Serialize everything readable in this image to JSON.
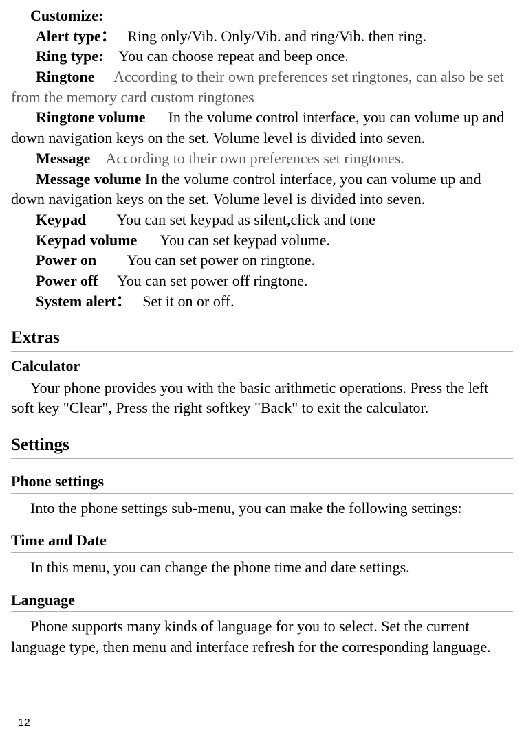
{
  "customize": {
    "header": "Customize:",
    "items": {
      "alert_type_label": "Alert type：",
      "alert_type_text": "Ring only/Vib. Only/Vib. and ring/Vib. then ring.",
      "ring_type_label": "Ring type:",
      "ring_type_text": "You can choose repeat and beep once.",
      "ringtone_label": "Ringtone",
      "ringtone_text": "According to their own preferences set ringtones, can also be set from the memory card custom ringtones",
      "ringtone_volume_label": "Ringtone volume",
      "ringtone_volume_text": "In the volume control interface, you can volume up and down navigation keys on the set. Volume level is divided into seven.",
      "message_label": "Message",
      "message_text": "According to their own preferences set ringtones.",
      "message_volume_label": "Message volume",
      "message_volume_text": " In the volume control interface, you can volume up and down navigation keys on the set. Volume level is divided into seven.",
      "keypad_label": "Keypad",
      "keypad_text": "You can set keypad as silent,click and tone",
      "keypad_volume_label": "Keypad volume",
      "keypad_volume_text": "You can set keypad volume.",
      "power_on_label": "Power on",
      "power_on_text": "You can set power on ringtone.",
      "power_off_label": "Power off",
      "power_off_text": "You can set power off ringtone.",
      "system_alert_label": "System alert：",
      "system_alert_text": "Set it on or off."
    }
  },
  "extras": {
    "heading": "Extras",
    "calculator_heading": "Calculator",
    "calculator_text": "Your phone provides you with the basic arithmetic operations. Press the left soft key \"Clear\", Press the right softkey \"Back\" to exit the calculator."
  },
  "settings": {
    "heading": "Settings",
    "phone_settings_heading": "Phone settings",
    "phone_settings_text": "Into the phone settings sub-menu, you can make the following settings:",
    "time_date_heading": "Time and Date",
    "time_date_text": "In this menu, you can change the phone time and date settings.",
    "language_heading": "Language",
    "language_text": "Phone supports many kinds of language for you to select. Set the current language type, then menu and interface refresh for the corresponding language."
  },
  "page_number": "12"
}
